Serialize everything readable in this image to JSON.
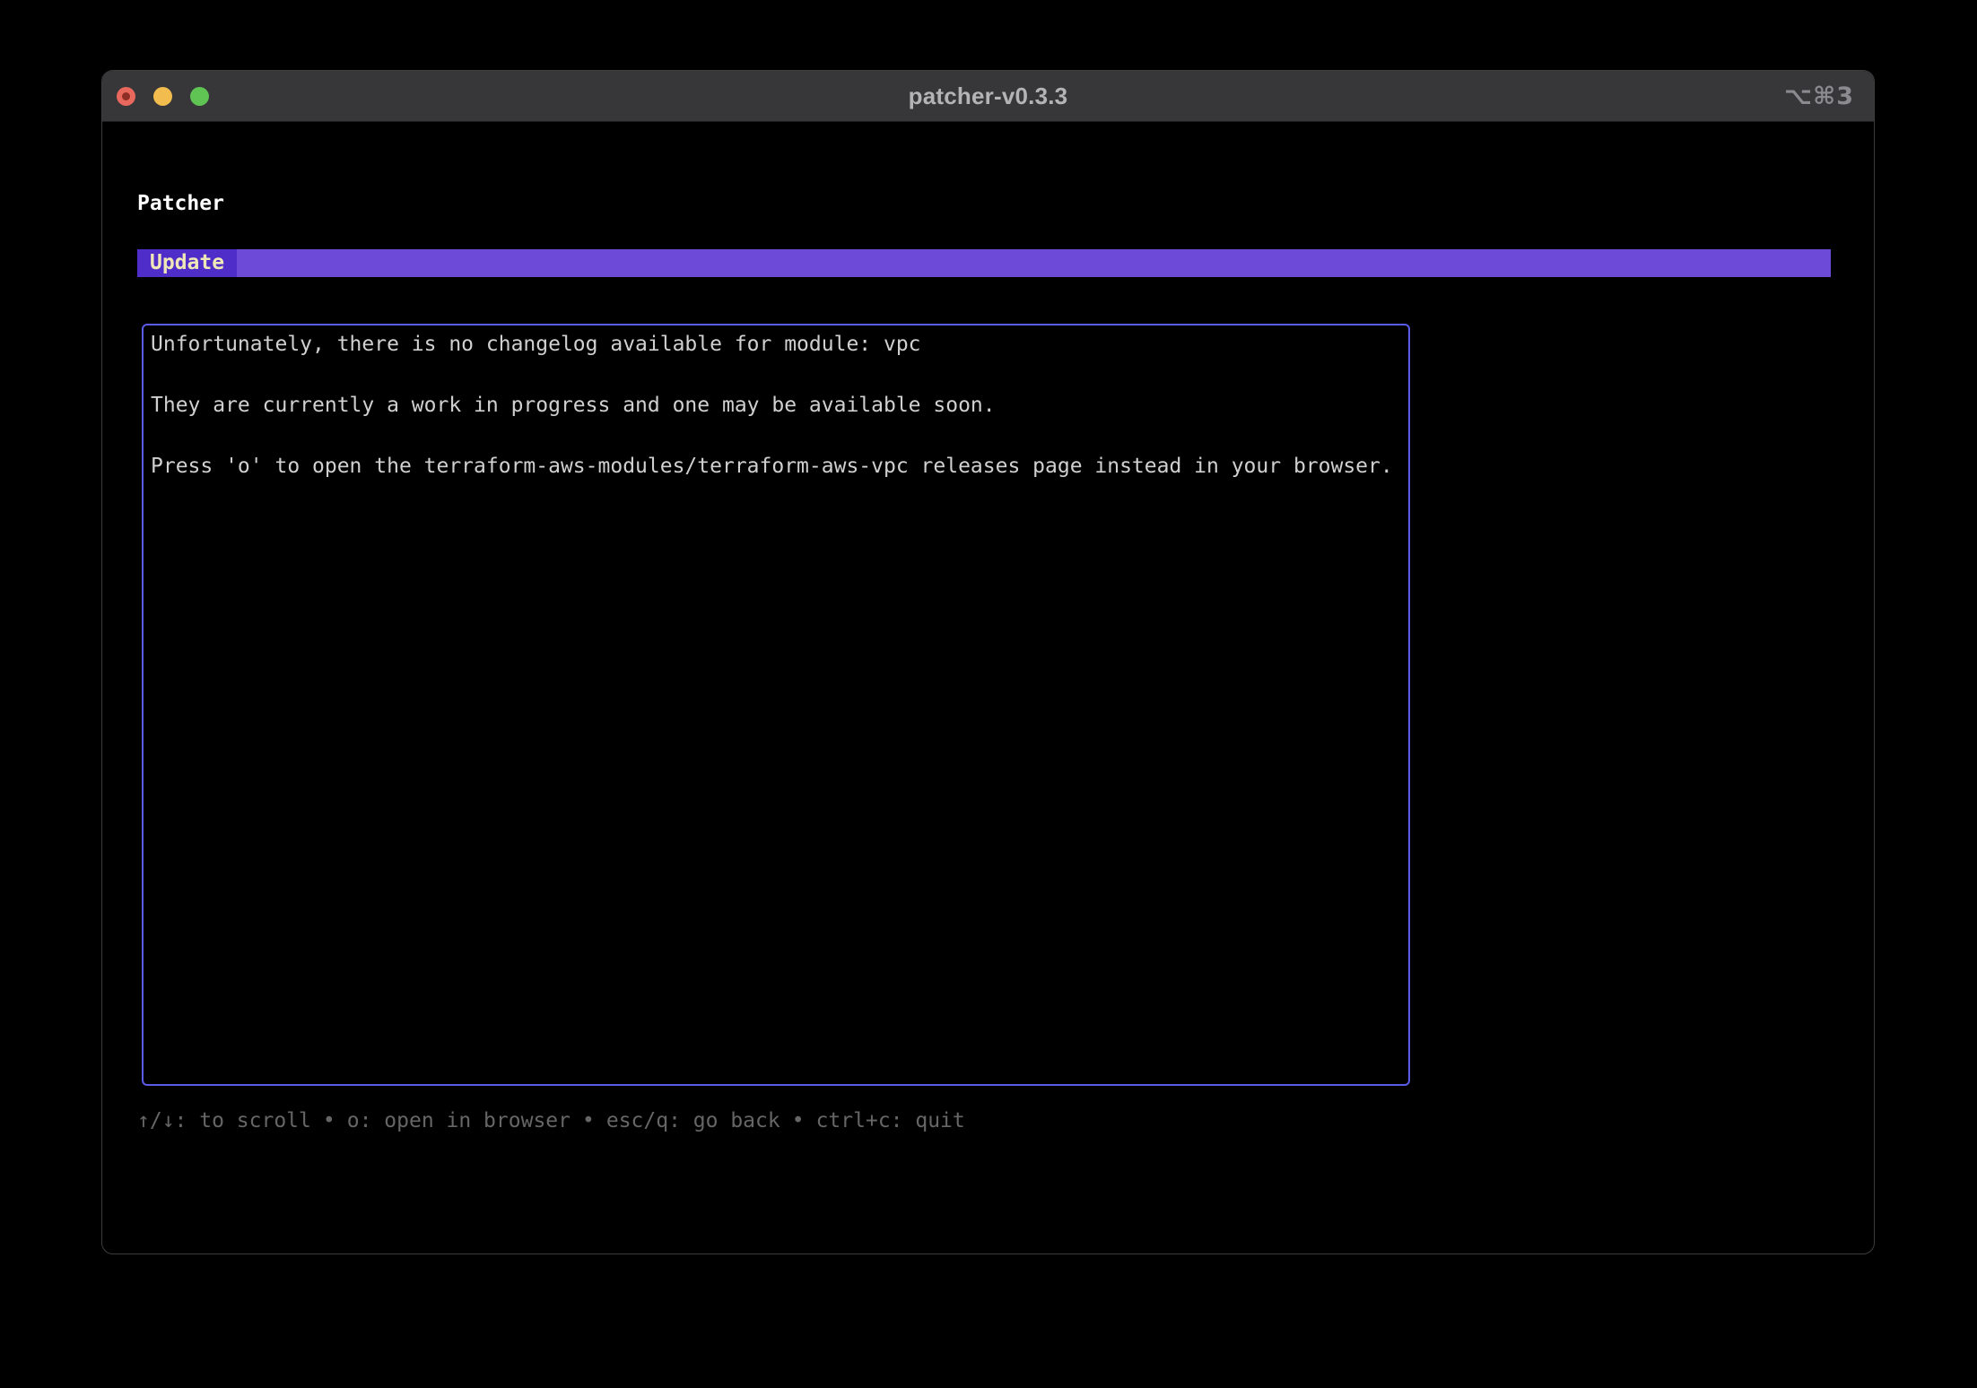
{
  "window": {
    "title": "patcher-v0.3.3",
    "shortcut_hint": "⌥⌘3",
    "traffic_lights": {
      "close_color": "#e8685d",
      "minimize_color": "#f2bd4e",
      "zoom_color": "#5fc454"
    }
  },
  "app": {
    "heading": "Patcher",
    "tabs": [
      {
        "label": "Update",
        "active": true
      }
    ],
    "changelog": {
      "lines": [
        "Unfortunately, there is no changelog available for module: vpc",
        "They are currently a work in progress and one may be available soon.",
        "Press 'o' to open the terraform-aws-modules/terraform-aws-vpc releases page instead in your browser."
      ]
    },
    "help": {
      "separator": "•",
      "items": [
        "↑/↓: to scroll",
        "o: open in browser",
        "esc/q: go back",
        "ctrl+c: quit"
      ]
    },
    "colors": {
      "tab_bar_bg": "#6e4ad9",
      "tab_active_bg": "#4f2dc8",
      "tab_text": "#f0e7b8",
      "box_border": "#5a5ce8",
      "terminal_text": "#d0d0d0",
      "heading_text": "#ffffff",
      "help_text": "#666666",
      "titlebar_bg": "#373739"
    }
  }
}
